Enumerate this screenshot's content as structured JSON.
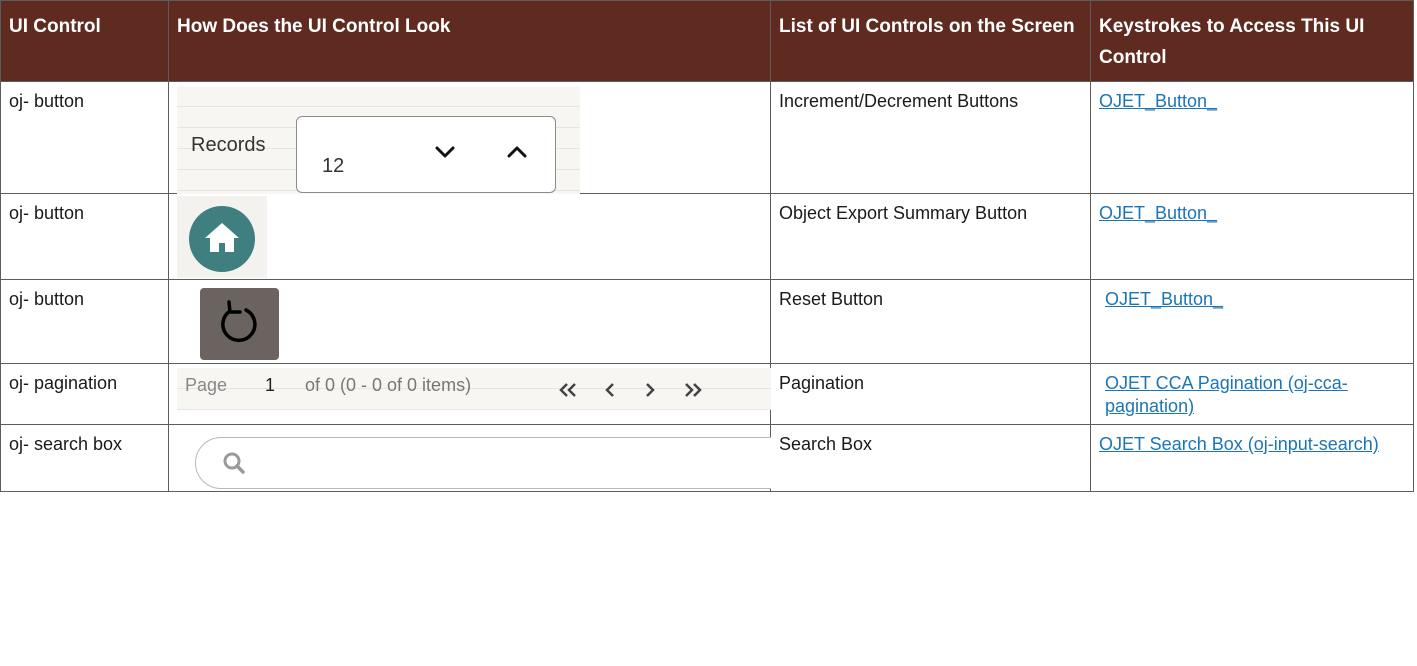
{
  "headers": {
    "col1": "UI Control",
    "col2": "How Does the UI Control Look",
    "col3": "List of UI Controls on the Screen",
    "col4": "Keystrokes to Access This UI Control"
  },
  "rows": [
    {
      "control": "oj- button",
      "list": "Increment/Decrement Buttons",
      "link": "OJET_Button_",
      "snippet": {
        "label": "Records",
        "value": "12",
        "icons": [
          "chevron-down-icon",
          "chevron-up-icon"
        ]
      }
    },
    {
      "control": "oj- button",
      "list": "Object Export Summary Button",
      "link": "OJET_Button_",
      "snippet": {
        "icon": "home-icon",
        "color": "#3f7f80"
      }
    },
    {
      "control": "oj- button",
      "list": "Reset Button",
      "link": "OJET_Button_",
      "snippet": {
        "icon": "reset-icon",
        "color": "#6b635f"
      }
    },
    {
      "control": "oj- pagination",
      "list": "Pagination",
      "link": "OJET CCA Pagination (oj-cca-pagination)",
      "snippet": {
        "page_label": "Page",
        "page_value": "1",
        "summary": "of 0 (0 - 0 of 0 items)",
        "icons": [
          "first-page-icon",
          "previous-page-icon",
          "next-page-icon",
          "last-page-icon"
        ]
      }
    },
    {
      "control": "oj- search box",
      "list": "Search Box",
      "link": "OJET Search Box (oj-input-search)",
      "snippet": {
        "icon": "search-icon"
      }
    }
  ],
  "colors": {
    "header_bg": "#5f2b21",
    "link": "#1b75b7"
  }
}
